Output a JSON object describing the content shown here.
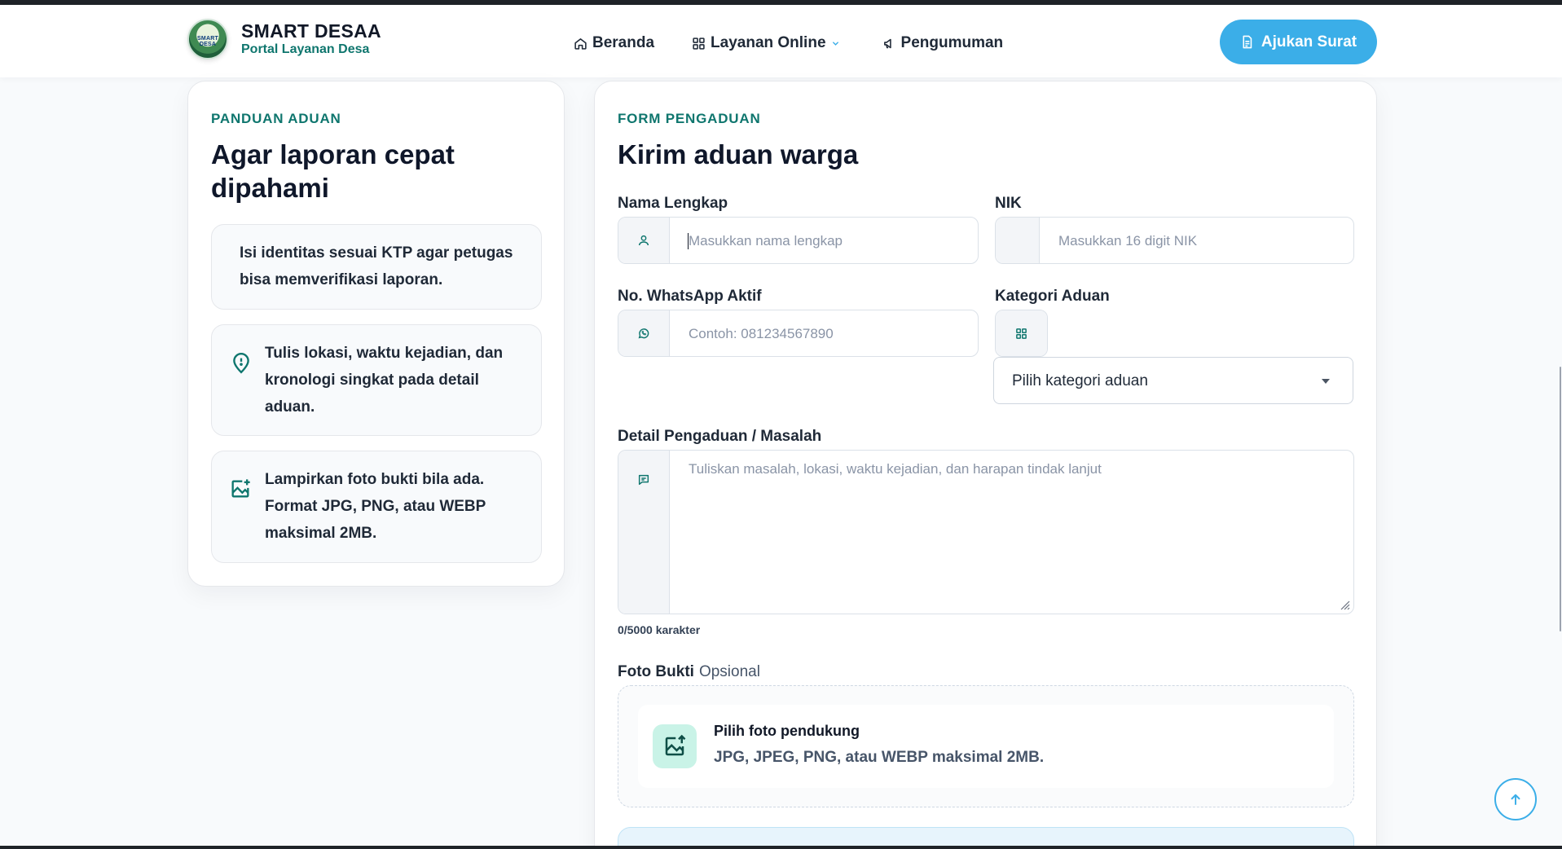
{
  "header": {
    "brand_title": "SMART DESAA",
    "brand_subtitle": "Portal Layanan Desa",
    "logo_text": "SMART DESA",
    "nav": [
      {
        "label": "Beranda",
        "icon": "home-icon"
      },
      {
        "label": "Layanan Online",
        "icon": "grid-icon",
        "has_dropdown": true
      },
      {
        "label": "Pengumuman",
        "icon": "megaphone-icon"
      }
    ],
    "cta_label": "Ajukan Surat",
    "cta_icon": "document-icon"
  },
  "guide": {
    "eyebrow": "PANDUAN ADUAN",
    "heading_line1": "Agar laporan cepat",
    "heading_line2": "dipahami",
    "tips": [
      {
        "line1": "Isi identitas sesuai KTP agar petugas",
        "line2": "bisa memverifikasi laporan.",
        "line3": ""
      },
      {
        "line1": "Tulis lokasi, waktu kejadian, dan",
        "line2": "kronologi singkat pada detail",
        "line3": "aduan.",
        "icon": "location-pin-icon"
      },
      {
        "line1": "Lampirkan foto bukti bila ada.",
        "line2": "Format JPG, PNG, atau WEBP",
        "line3": "maksimal 2MB.",
        "icon": "image-plus-icon"
      }
    ]
  },
  "form": {
    "eyebrow": "FORM PENGADUAN",
    "heading": "Kirim aduan warga",
    "name": {
      "label": "Nama Lengkap",
      "placeholder": "Masukkan nama lengkap"
    },
    "nik": {
      "label": "NIK",
      "placeholder": "Masukkan 16 digit NIK"
    },
    "whatsapp": {
      "label": "No. WhatsApp Aktif",
      "placeholder": "Contoh: 081234567890"
    },
    "category": {
      "label": "Kategori Aduan",
      "selected": "Pilih kategori aduan"
    },
    "detail": {
      "label": "Detail Pengaduan / Masalah",
      "placeholder": "Tuliskan masalah, lokasi, waktu kejadian, dan harapan tindak lanjut",
      "counter": "0/5000 karakter"
    },
    "photo": {
      "label": "Foto Bukti",
      "optional": "Opsional",
      "title": "Pilih foto pendukung",
      "hint": "JPG, JPEG, PNG, atau WEBP maksimal 2MB."
    }
  },
  "colors": {
    "accent": "#3baee8",
    "brand_green": "#0f766e",
    "icon_mint": "#c9f3e7"
  }
}
